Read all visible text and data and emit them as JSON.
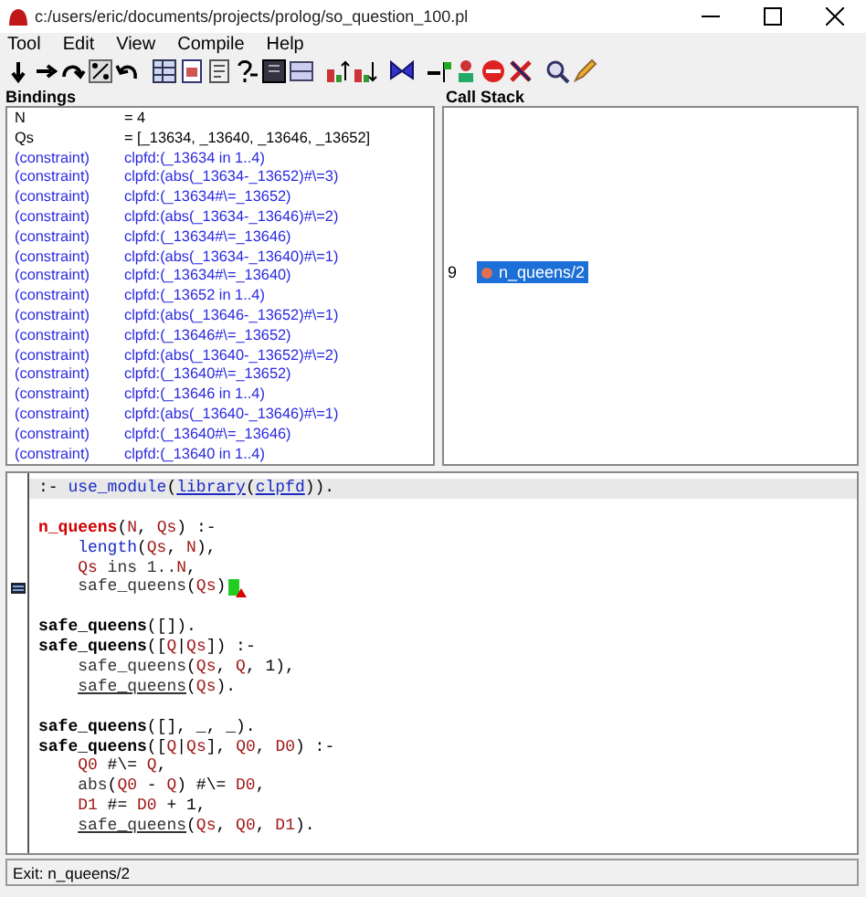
{
  "window": {
    "title": "c:/users/eric/documents/projects/prolog/so_question_100.pl"
  },
  "menu": [
    {
      "label": "Tool"
    },
    {
      "label": "Edit"
    },
    {
      "label": "View"
    },
    {
      "label": "Compile"
    },
    {
      "label": "Help"
    }
  ],
  "bindings": {
    "title": "Bindings",
    "rows": [
      {
        "kind": "binding",
        "name": "N",
        "value": "= 4"
      },
      {
        "kind": "binding",
        "name": "Qs",
        "value": "= [_13634, _13640, _13646, _13652]"
      },
      {
        "kind": "constraint",
        "name": "(constraint)",
        "value": "clpfd:(_13634 in 1..4)"
      },
      {
        "kind": "constraint",
        "name": "(constraint)",
        "value": "clpfd:(abs(_13634-_13652)#\\=3)"
      },
      {
        "kind": "constraint",
        "name": "(constraint)",
        "value": "clpfd:(_13634#\\=_13652)"
      },
      {
        "kind": "constraint",
        "name": "(constraint)",
        "value": "clpfd:(abs(_13634-_13646)#\\=2)"
      },
      {
        "kind": "constraint",
        "name": "(constraint)",
        "value": "clpfd:(_13634#\\=_13646)"
      },
      {
        "kind": "constraint",
        "name": "(constraint)",
        "value": "clpfd:(abs(_13634-_13640)#\\=1)"
      },
      {
        "kind": "constraint",
        "name": "(constraint)",
        "value": "clpfd:(_13634#\\=_13640)"
      },
      {
        "kind": "constraint",
        "name": "(constraint)",
        "value": "clpfd:(_13652 in 1..4)"
      },
      {
        "kind": "constraint",
        "name": "(constraint)",
        "value": "clpfd:(abs(_13646-_13652)#\\=1)"
      },
      {
        "kind": "constraint",
        "name": "(constraint)",
        "value": "clpfd:(_13646#\\=_13652)"
      },
      {
        "kind": "constraint",
        "name": "(constraint)",
        "value": "clpfd:(abs(_13640-_13652)#\\=2)"
      },
      {
        "kind": "constraint",
        "name": "(constraint)",
        "value": "clpfd:(_13640#\\=_13652)"
      },
      {
        "kind": "constraint",
        "name": "(constraint)",
        "value": "clpfd:(_13646 in 1..4)"
      },
      {
        "kind": "constraint",
        "name": "(constraint)",
        "value": "clpfd:(abs(_13640-_13646)#\\=1)"
      },
      {
        "kind": "constraint",
        "name": "(constraint)",
        "value": "clpfd:(_13640#\\=_13646)"
      },
      {
        "kind": "constraint",
        "name": "(constraint)",
        "value": "clpfd:(_13640 in 1..4)"
      }
    ]
  },
  "call_stack": {
    "title": "Call Stack",
    "frames": [
      {
        "depth": "9",
        "label": "n_queens/2",
        "selected": true
      }
    ]
  },
  "editor": {
    "lines": [
      {
        "highlighted": true,
        "current": false,
        "space_before": false,
        "indent": false,
        "tokens": [
          {
            "kind": "plain",
            "text": ":- "
          },
          {
            "kind": "builtin",
            "text": "use_module"
          },
          {
            "kind": "plain",
            "text": "("
          },
          {
            "kind": "library",
            "text": "library"
          },
          {
            "kind": "plain",
            "text": "("
          },
          {
            "kind": "library",
            "text": "clpfd"
          },
          {
            "kind": "plain",
            "text": "))."
          }
        ]
      },
      {
        "highlighted": false,
        "current": false,
        "space_before": true,
        "indent": false,
        "tokens": [
          {
            "kind": "head",
            "text": "n_queens"
          },
          {
            "kind": "plain",
            "text": "("
          },
          {
            "kind": "var",
            "text": "N"
          },
          {
            "kind": "plain",
            "text": ", "
          },
          {
            "kind": "var",
            "text": "Qs"
          },
          {
            "kind": "plain",
            "text": ") :-"
          }
        ]
      },
      {
        "highlighted": false,
        "current": false,
        "space_before": false,
        "indent": true,
        "tokens": [
          {
            "kind": "builtin",
            "text": "length"
          },
          {
            "kind": "plain",
            "text": "("
          },
          {
            "kind": "var",
            "text": "Qs"
          },
          {
            "kind": "plain",
            "text": ", "
          },
          {
            "kind": "var",
            "text": "N"
          },
          {
            "kind": "plain",
            "text": "),"
          }
        ]
      },
      {
        "highlighted": false,
        "current": false,
        "space_before": false,
        "indent": true,
        "tokens": [
          {
            "kind": "var",
            "text": "Qs"
          },
          {
            "kind": "goal",
            "text": " ins 1.."
          },
          {
            "kind": "var",
            "text": "N"
          },
          {
            "kind": "plain",
            "text": ","
          }
        ]
      },
      {
        "highlighted": false,
        "current": true,
        "space_before": false,
        "indent": true,
        "tokens": [
          {
            "kind": "goal",
            "text": "safe_queens"
          },
          {
            "kind": "plain",
            "text": "("
          },
          {
            "kind": "var",
            "text": "Qs"
          },
          {
            "kind": "plain",
            "text": ")"
          }
        ]
      },
      {
        "highlighted": false,
        "current": false,
        "space_before": true,
        "indent": false,
        "tokens": [
          {
            "kind": "defined",
            "text": "safe_queens"
          },
          {
            "kind": "plain",
            "text": "([])."
          }
        ]
      },
      {
        "highlighted": false,
        "current": false,
        "space_before": false,
        "indent": false,
        "tokens": [
          {
            "kind": "defined",
            "text": "safe_queens"
          },
          {
            "kind": "plain",
            "text": "(["
          },
          {
            "kind": "var",
            "text": "Q"
          },
          {
            "kind": "plain",
            "text": "|"
          },
          {
            "kind": "var",
            "text": "Qs"
          },
          {
            "kind": "plain",
            "text": "]) :-"
          }
        ]
      },
      {
        "highlighted": false,
        "current": false,
        "space_before": false,
        "indent": true,
        "tokens": [
          {
            "kind": "goal",
            "text": "safe_queens"
          },
          {
            "kind": "plain",
            "text": "("
          },
          {
            "kind": "var",
            "text": "Qs"
          },
          {
            "kind": "plain",
            "text": ", "
          },
          {
            "kind": "var",
            "text": "Q"
          },
          {
            "kind": "plain",
            "text": ", 1),"
          }
        ]
      },
      {
        "highlighted": false,
        "current": false,
        "space_before": false,
        "indent": true,
        "tokens": [
          {
            "kind": "called",
            "text": "safe_queens"
          },
          {
            "kind": "plain",
            "text": "("
          },
          {
            "kind": "var",
            "text": "Qs"
          },
          {
            "kind": "plain",
            "text": ")."
          }
        ]
      },
      {
        "highlighted": false,
        "current": false,
        "space_before": true,
        "indent": false,
        "tokens": [
          {
            "kind": "defined",
            "text": "safe_queens"
          },
          {
            "kind": "plain",
            "text": "([], _, _)."
          }
        ]
      },
      {
        "highlighted": false,
        "current": false,
        "space_before": false,
        "indent": false,
        "tokens": [
          {
            "kind": "defined",
            "text": "safe_queens"
          },
          {
            "kind": "plain",
            "text": "(["
          },
          {
            "kind": "var",
            "text": "Q"
          },
          {
            "kind": "plain",
            "text": "|"
          },
          {
            "kind": "var",
            "text": "Qs"
          },
          {
            "kind": "plain",
            "text": "], "
          },
          {
            "kind": "var",
            "text": "Q0"
          },
          {
            "kind": "plain",
            "text": ", "
          },
          {
            "kind": "var",
            "text": "D0"
          },
          {
            "kind": "plain",
            "text": ") :-"
          }
        ]
      },
      {
        "highlighted": false,
        "current": false,
        "space_before": false,
        "indent": true,
        "tokens": [
          {
            "kind": "var",
            "text": "Q0"
          },
          {
            "kind": "plain",
            "text": " #\\= "
          },
          {
            "kind": "var",
            "text": "Q"
          },
          {
            "kind": "plain",
            "text": ","
          }
        ]
      },
      {
        "highlighted": false,
        "current": false,
        "space_before": false,
        "indent": true,
        "tokens": [
          {
            "kind": "goal",
            "text": "abs"
          },
          {
            "kind": "plain",
            "text": "("
          },
          {
            "kind": "var",
            "text": "Q0"
          },
          {
            "kind": "plain",
            "text": " - "
          },
          {
            "kind": "var",
            "text": "Q"
          },
          {
            "kind": "plain",
            "text": ") #\\= "
          },
          {
            "kind": "var",
            "text": "D0"
          },
          {
            "kind": "plain",
            "text": ","
          }
        ]
      },
      {
        "highlighted": false,
        "current": false,
        "space_before": false,
        "indent": true,
        "tokens": [
          {
            "kind": "var",
            "text": "D1"
          },
          {
            "kind": "plain",
            "text": " #= "
          },
          {
            "kind": "var",
            "text": "D0"
          },
          {
            "kind": "plain",
            "text": " + 1,"
          }
        ]
      },
      {
        "highlighted": false,
        "current": false,
        "space_before": false,
        "indent": true,
        "tokens": [
          {
            "kind": "called",
            "text": "safe_queens"
          },
          {
            "kind": "plain",
            "text": "("
          },
          {
            "kind": "var",
            "text": "Qs"
          },
          {
            "kind": "plain",
            "text": ", "
          },
          {
            "kind": "var",
            "text": "Q0"
          },
          {
            "kind": "plain",
            "text": ", "
          },
          {
            "kind": "var",
            "text": "D1"
          },
          {
            "kind": "plain",
            "text": ")."
          }
        ]
      }
    ]
  },
  "status_bar": {
    "text": "Exit: n_queens/2"
  }
}
